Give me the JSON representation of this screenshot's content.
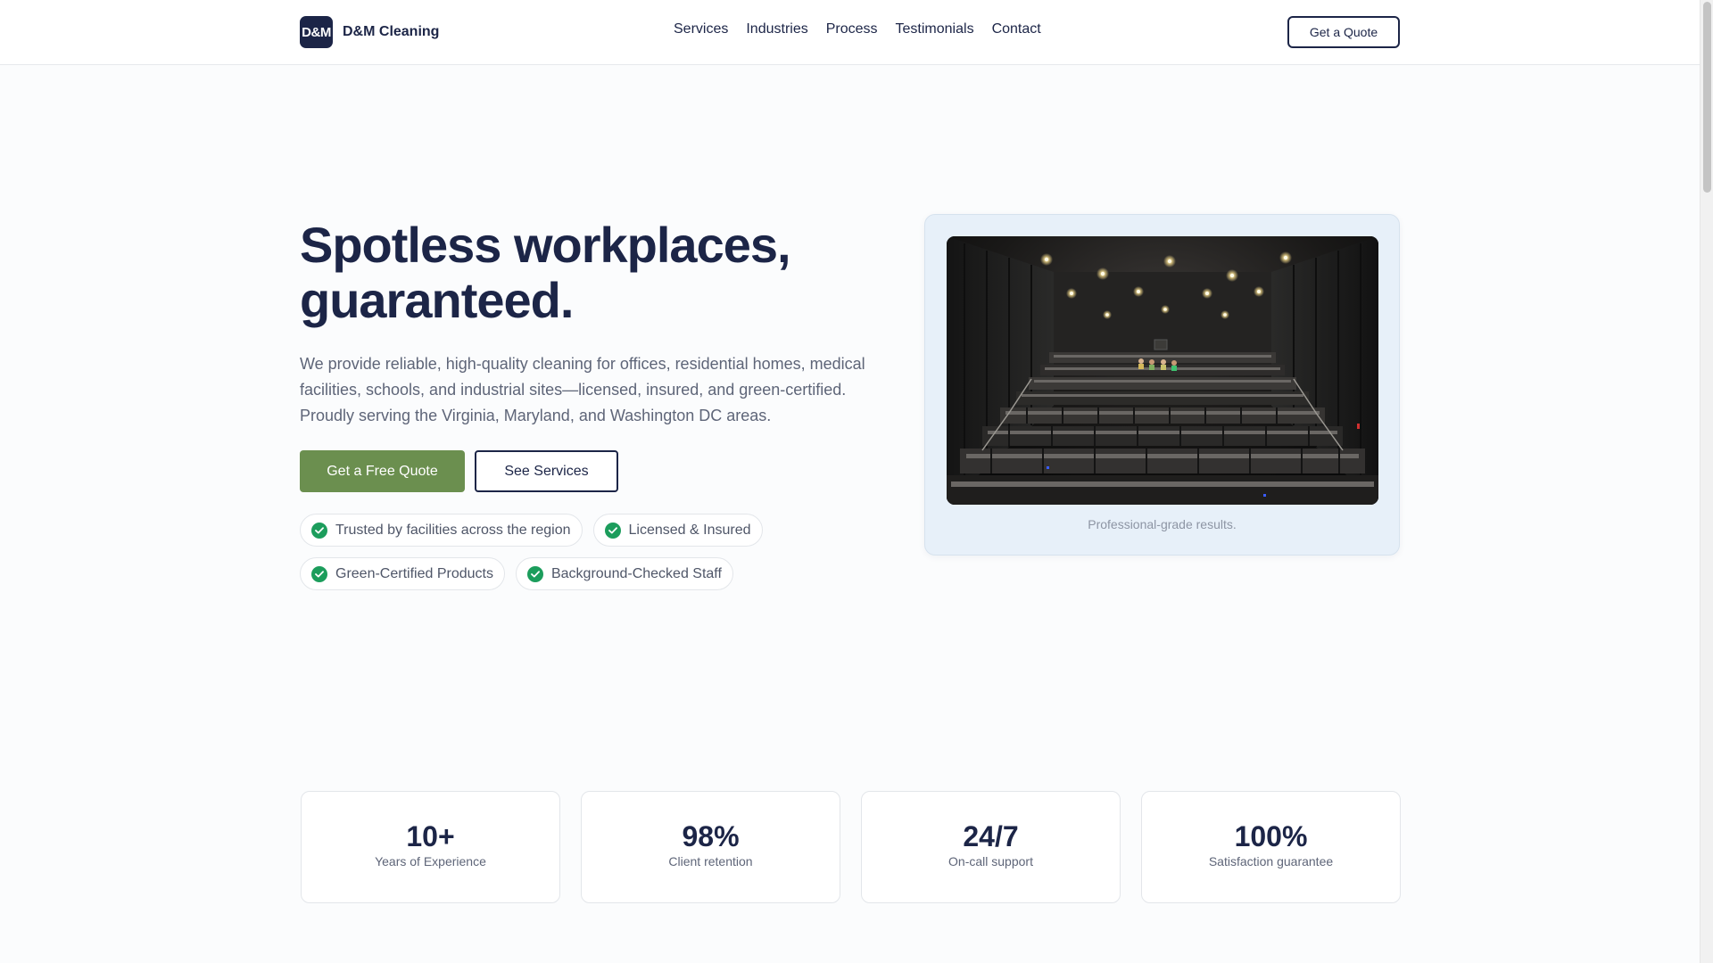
{
  "brand": {
    "logo_text": "D&M",
    "name": "D&M Cleaning"
  },
  "nav": {
    "items": [
      {
        "label": "Services"
      },
      {
        "label": "Industries"
      },
      {
        "label": "Process"
      },
      {
        "label": "Testimonials"
      },
      {
        "label": "Contact"
      }
    ],
    "cta_label": "Get a Quote"
  },
  "hero": {
    "title_line1": "Spotless workplaces,",
    "title_line2": "guaranteed.",
    "description": "We provide reliable, high-quality cleaning for offices, residential homes, medical facilities, schools, and industrial sites—licensed, insured, and green-certified. Proudly serving the Virginia, Maryland, and Washington DC areas.",
    "primary_button": "Get a Free Quote",
    "secondary_button": "See Services",
    "badges": [
      {
        "label": "Trusted by facilities across the region"
      },
      {
        "label": "Licensed & Insured"
      },
      {
        "label": "Green-Certified Products"
      },
      {
        "label": "Background-Checked Staff"
      }
    ]
  },
  "media": {
    "caption": "Professional-grade results.",
    "image_icon": "theater-photo"
  },
  "stats": [
    {
      "value": "10+",
      "label": "Years of Experience"
    },
    {
      "value": "98%",
      "label": "Client retention"
    },
    {
      "value": "24/7",
      "label": "On-call support"
    },
    {
      "value": "100%",
      "label": "Satisfaction guarantee"
    }
  ],
  "colors": {
    "navy": "#1c2547",
    "accent_green": "#6b8f4f",
    "check_green": "#1c9d5c",
    "card_tint": "#e7f0f9"
  }
}
